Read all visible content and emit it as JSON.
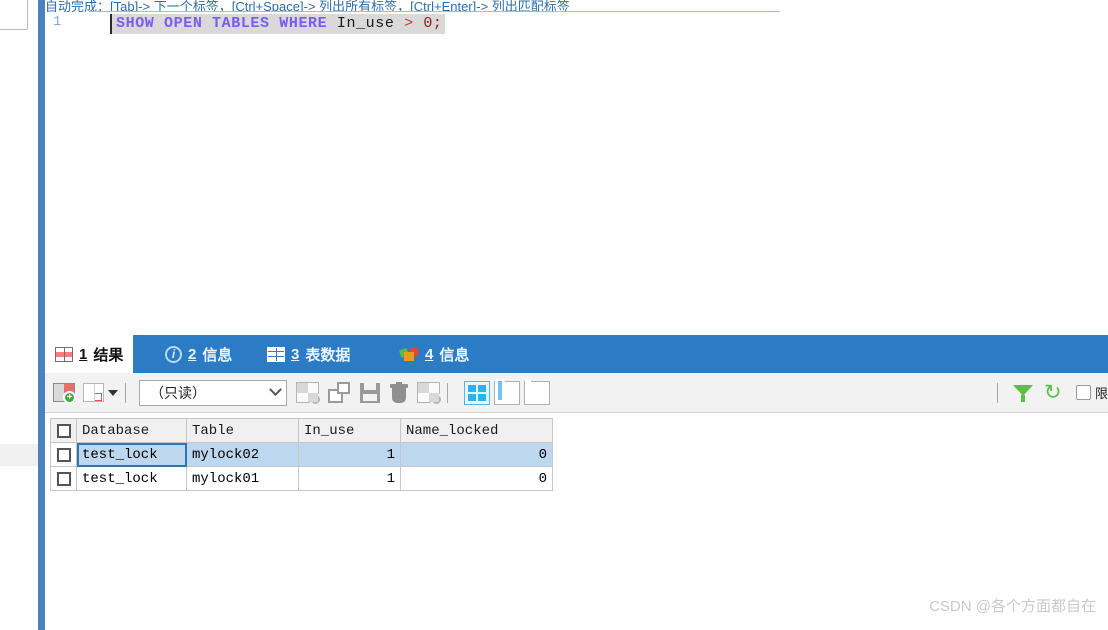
{
  "editor": {
    "hint_text": "自动完成：[Tab]-> 下一个标签，[Ctrl+Space]-> 列出所有标签，[Ctrl+Enter]-> 列出匹配标签",
    "line_number": "1",
    "sql_tokens": {
      "kw_show": "SHOW",
      "kw_open": "OPEN",
      "kw_tables": "TABLES",
      "kw_where": "WHERE",
      "ident": "In_use",
      "op": ">",
      "num": "0;"
    }
  },
  "tabs": [
    {
      "num": "1",
      "label": "结果",
      "icon": "grid-red-icon",
      "active": true
    },
    {
      "num": "2",
      "label": "信息",
      "icon": "info-circle-icon",
      "active": false
    },
    {
      "num": "3",
      "label": "表数据",
      "icon": "grid-white-icon",
      "active": false
    },
    {
      "num": "4",
      "label": "信息",
      "icon": "chart-shapes-icon",
      "active": false
    }
  ],
  "toolbar": {
    "edit_row_title": "编辑行",
    "grid_select_title": "网格选择",
    "mode_value": "（只读）",
    "mode_placeholder": "（只读）",
    "add_row_title": "添加行",
    "duplicate_row_title": "复制行",
    "save_title": "保存",
    "delete_title": "删除",
    "cancel_title": "取消",
    "view_grid_title": "网格视图",
    "view_form_title": "表单视图",
    "view_text_title": "文本视图",
    "filter_title": "筛选",
    "refresh_title": "刷新",
    "checkbox_label": "限"
  },
  "grid": {
    "columns": [
      "Database",
      "Table",
      "In_use",
      "Name_locked"
    ],
    "selected_column": "Database",
    "rows": [
      {
        "database": "test_lock",
        "table": "mylock02",
        "in_use": "1",
        "name_locked": "0",
        "selected": true
      },
      {
        "database": "test_lock",
        "table": "mylock01",
        "in_use": "1",
        "name_locked": "0",
        "selected": false
      }
    ]
  },
  "watermark": {
    "text": "CSDN @各个方面都自在"
  },
  "colors": {
    "tabstrip_blue": "#2b7cc4",
    "accent_blue": "#4a81be",
    "selected_row": "#bdd7ee",
    "header_selected": "#3aa0e8",
    "green": "#5cbf4a"
  }
}
